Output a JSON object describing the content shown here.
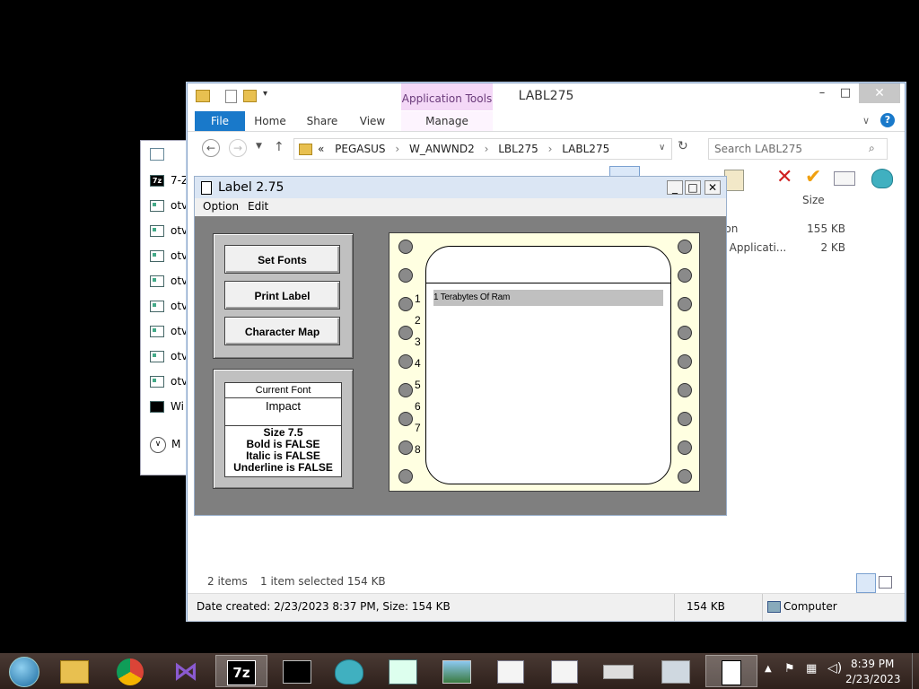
{
  "background_explorer": {
    "items": [
      "7-Z",
      "otv",
      "otv",
      "otv",
      "otv",
      "otv",
      "otv",
      "otv",
      "otv",
      "Wi"
    ],
    "more_label": "M"
  },
  "explorer": {
    "title": "LABL275",
    "contextual_tab_group": "Application Tools",
    "tabs": [
      "File",
      "Home",
      "Share",
      "View",
      "Manage"
    ],
    "address": {
      "prefix": "«",
      "crumbs": [
        "PEGASUS",
        "W_ANWND2",
        "LBL275",
        "LABL275"
      ]
    },
    "search_placeholder": "Search LABL275",
    "column_size": "Size",
    "files": [
      {
        "type": "ation",
        "size": "155 KB"
      },
      {
        "type": "DS Applicati...",
        "size": "2 KB"
      }
    ],
    "status": {
      "items": "2 items",
      "selected": "1 item selected  154 KB"
    },
    "details": {
      "text": "Date created: 2/23/2023 8:37 PM, Size: 154 KB",
      "size": "154 KB",
      "location": "Computer"
    },
    "caption": {
      "minimize": "–",
      "maximize": "□",
      "close": "✕"
    }
  },
  "label_app": {
    "title": "Label 2.75",
    "menu": [
      "Option",
      "Edit"
    ],
    "buttons": {
      "set_fonts": "Set Fonts",
      "print_label": "Print Label",
      "character_map": "Character Map"
    },
    "font": {
      "header": "Current Font",
      "name": "Impact",
      "size": "Size  7.5",
      "bold": "Bold is FALSE",
      "italic": "Italic is FALSE",
      "underline": "Underline is FALSE"
    },
    "line_numbers": [
      "1",
      "2",
      "3",
      "4",
      "5",
      "6",
      "7",
      "8"
    ],
    "label_line1": "1 Terabytes Of Ram"
  },
  "taskbar": {
    "time": "8:39 PM",
    "date": "2/23/2023",
    "apps": [
      "start-orb",
      "file-explorer",
      "chrome",
      "visual-studio",
      "7zip",
      "command-prompt",
      "shell-app",
      "vcdicp",
      "photo-viewer",
      "notepad-window",
      "notepad-window-2",
      "drive",
      "system-monitor",
      "label-app"
    ]
  },
  "colors": {
    "accent": "#1979ca",
    "label_bg": "#ffffe1",
    "context_tab": "#f4d8f7"
  }
}
